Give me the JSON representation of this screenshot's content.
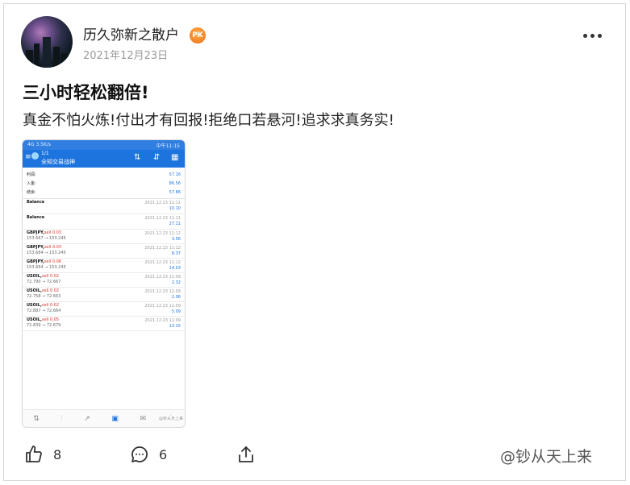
{
  "post": {
    "author": "历久弥新之散户",
    "badge": "PK",
    "date": "2021年12月23日",
    "title": "三小时轻松翻倍!",
    "body": "真金不怕火炼!付出才有回报!拒绝口若悬河!追求求真务实!"
  },
  "screenshot": {
    "status_left": "4G 3.5K/s",
    "status_right": "中午11:15",
    "account_number": "1/1",
    "account_name": "全知交易战神",
    "summary": [
      {
        "label": "利润:",
        "value": "57.16"
      },
      {
        "label": "入金:",
        "value": "86.56"
      },
      {
        "label": "结余:",
        "value": "57.86"
      }
    ],
    "rows": [
      {
        "symbol": "Balance",
        "action": "",
        "prices": "",
        "time": "2021.12.23 11:11",
        "profit": "10.10"
      },
      {
        "symbol": "Balance",
        "action": "",
        "prices": "",
        "time": "2021.12.23 11:11",
        "profit": "27.11"
      },
      {
        "symbol": "GBPJPY,",
        "action": "sell 0.03",
        "prices": "153.667 → 153.245",
        "time": "2021.12.23 11:12",
        "profit": "3.56"
      },
      {
        "symbol": "GBPJPY,",
        "action": "sell 0.03",
        "prices": "153.664 → 153.245",
        "time": "2021.12.23 11:12",
        "profit": "8.37"
      },
      {
        "symbol": "GBPJPY,",
        "action": "sell 0.06",
        "prices": "153.664 → 153.245",
        "time": "2021.12.23 11:12",
        "profit": "14.03"
      },
      {
        "symbol": "USOIL,",
        "action": "sell 0.02",
        "prices": "72.790 → 72.667",
        "time": "2021.12.23 11:09",
        "profit": "2.32"
      },
      {
        "symbol": "USOIL,",
        "action": "sell 0.02",
        "prices": "72.758 → 72.663",
        "time": "2021.12.23 11:09",
        "profit": "2.06"
      },
      {
        "symbol": "USOIL,",
        "action": "sell 0.02",
        "prices": "72.887 → 72.664",
        "time": "2021.12.23 11:09",
        "profit": "5.09"
      },
      {
        "symbol": "USOIL,",
        "action": "sell 0.05",
        "prices": "72.839 → 72.679",
        "time": "2021.12.23 11:09",
        "profit": "13.15"
      }
    ],
    "watermark": "@钞从天上来"
  },
  "actions": {
    "like_count": "8",
    "comment_count": "6"
  },
  "watermark": "@钞从天上来",
  "icons": {
    "more": "more-dots-icon",
    "like": "thumbs-up-icon",
    "comment": "comment-bubble-icon",
    "share": "share-icon"
  },
  "colors": {
    "app_blue": "#1e74de",
    "sell_red": "#d9342b",
    "badge_orange": "#f06a16"
  }
}
